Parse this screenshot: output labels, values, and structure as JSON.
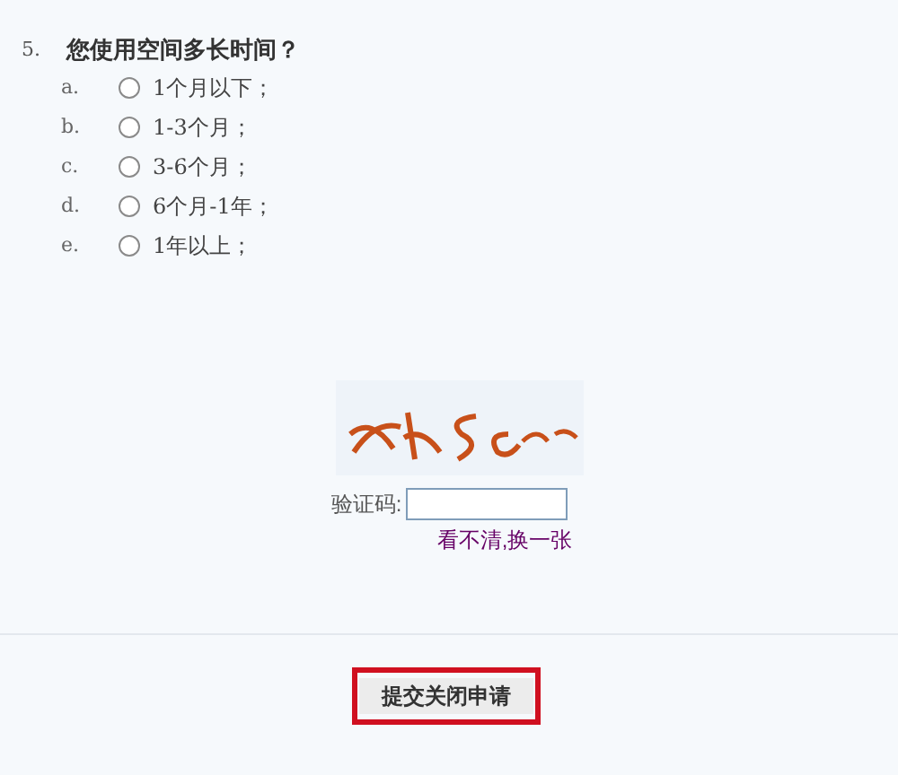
{
  "question": {
    "number": "5.",
    "title": "您使用空间多长时间？",
    "options": [
      {
        "letter": "a.",
        "label": "1个月以下；",
        "selected": false
      },
      {
        "letter": "b.",
        "label": "1-3个月；",
        "selected": false
      },
      {
        "letter": "c.",
        "label": "3-6个月；",
        "selected": false
      },
      {
        "letter": "d.",
        "label": "6个月-1年；",
        "selected": false
      },
      {
        "letter": "e.",
        "label": "1年以上；",
        "selected": false
      }
    ]
  },
  "captcha": {
    "kind": "picture",
    "label": "验证码:",
    "refresh_link": "看不清,换一张"
  },
  "submit_button": {
    "label": "提交关闭申请",
    "highlighted": true
  }
}
